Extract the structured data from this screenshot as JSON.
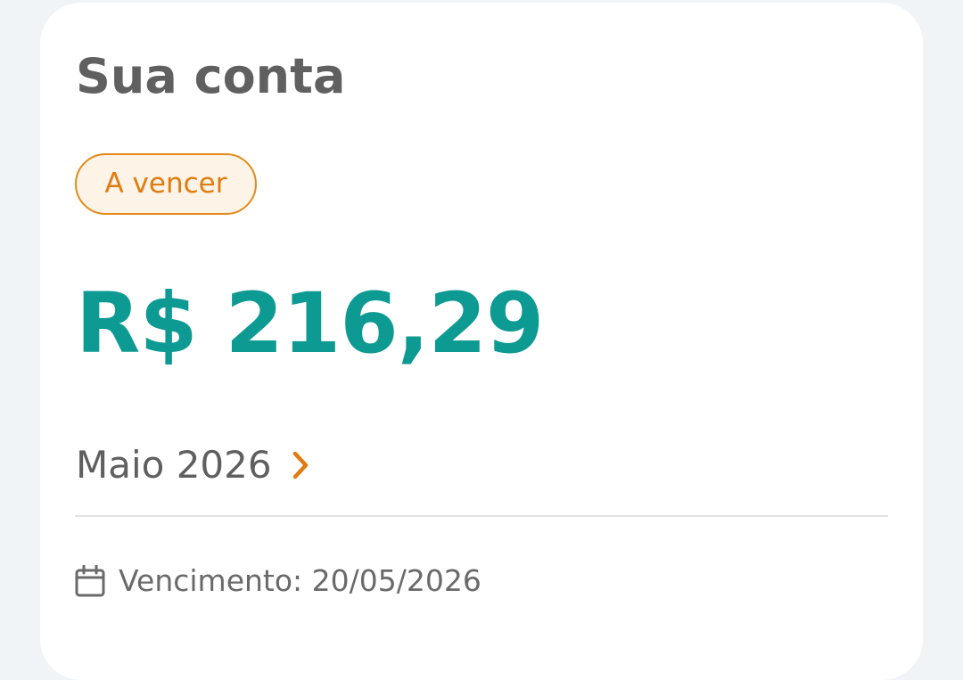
{
  "card": {
    "title": "Sua conta",
    "status_badge": "A vencer",
    "amount": "R$ 216,29",
    "month_label": "Maio 2026",
    "due_label": "Vencimento: 20/05/2026"
  },
  "icons": {
    "chevron": "chevron-right-icon",
    "calendar": "calendar-icon"
  },
  "colors": {
    "amount": "#0d9a92",
    "badge_text": "#e07b10",
    "badge_border": "#e38a1a",
    "badge_bg": "#fdf3e7",
    "chevron": "#e07b10"
  }
}
